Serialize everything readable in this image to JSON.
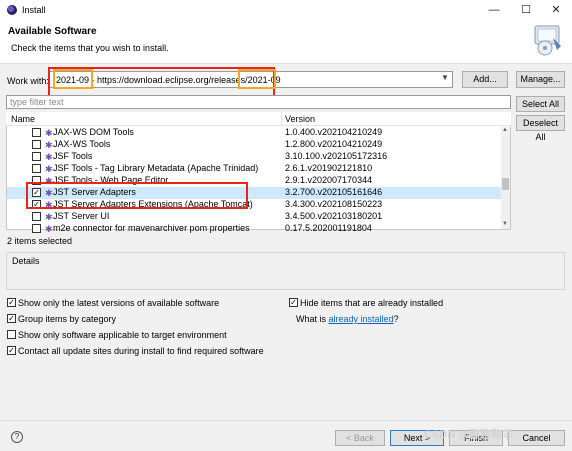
{
  "window": {
    "title": "Install"
  },
  "header": {
    "title": "Available Software",
    "subtitle": "Check the items that you wish to install."
  },
  "work_with": {
    "label": "Work with:",
    "value": "2021-09 - https://download.eclipse.org/releases/2021-09",
    "add_label": "Add...",
    "manage_label": "Manage..."
  },
  "filter": {
    "placeholder": "type filter text"
  },
  "buttons": {
    "select_all": "Select All",
    "deselect_all": "Deselect All"
  },
  "table": {
    "columns": [
      "Name",
      "Version"
    ],
    "rows": [
      {
        "name": "JAX-WS DOM Tools",
        "version": "1.0.400.v202104210249",
        "checked": false,
        "selected": false
      },
      {
        "name": "JAX-WS Tools",
        "version": "1.2.800.v202104210249",
        "checked": false,
        "selected": false
      },
      {
        "name": "JSF Tools",
        "version": "3.10.100.v202105172316",
        "checked": false,
        "selected": false
      },
      {
        "name": "JSF Tools - Tag Library Metadata (Apache Trinidad)",
        "version": "2.6.1.v201902121810",
        "checked": false,
        "selected": false
      },
      {
        "name": "JSF Tools - Web Page Editor",
        "version": "2.9.1.v202007170344",
        "checked": false,
        "selected": false
      },
      {
        "name": "JST Server Adapters",
        "version": "3.2.700.v202105161646",
        "checked": true,
        "selected": true
      },
      {
        "name": "JST Server Adapters Extensions (Apache Tomcat)",
        "version": "3.4.300.v202108150223",
        "checked": true,
        "selected": false
      },
      {
        "name": "JST Server UI",
        "version": "3.4.500.v202103180201",
        "checked": false,
        "selected": false
      },
      {
        "name": "m2e connector for mavenarchiver pom properties",
        "version": "0.17.5.202001191804",
        "checked": false,
        "selected": false
      }
    ]
  },
  "status": "2 items selected",
  "details": {
    "label": "Details"
  },
  "options": {
    "latest_versions": {
      "label": "Show only the latest versions of available software",
      "checked": true
    },
    "group_by_category": {
      "label": "Group items by category",
      "checked": true
    },
    "target_env": {
      "label": "Show only software applicable to target environment",
      "checked": false
    },
    "contact_sites": {
      "label": "Contact all update sites during install to find required software",
      "checked": true
    },
    "hide_installed": {
      "label": "Hide items that are already installed",
      "checked": true
    },
    "what_is": {
      "prefix": "What is ",
      "link": "already installed",
      "suffix": "?"
    }
  },
  "footer": {
    "back": "< Back",
    "next": "Next >",
    "finish": "Finish",
    "cancel": "Cancel"
  },
  "watermark": "CSDN @憨憨憨羊",
  "icons": {
    "app": "eclipse-icon",
    "wizard": "install-wizard-icon",
    "item": "plugin-icon",
    "help": "help-icon"
  },
  "colors": {
    "annotation_red": "#e8251d",
    "annotation_orange": "#f5a623",
    "selection": "#cde8ff",
    "link": "#0a64c8"
  }
}
